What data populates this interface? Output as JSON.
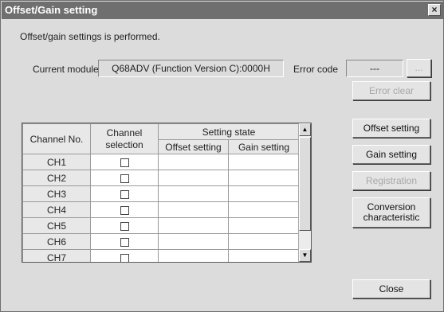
{
  "window": {
    "title": "Offset/Gain setting",
    "close_glyph": "×"
  },
  "message": "Offset/gain settings is performed.",
  "module": {
    "label": "Current module",
    "value": "Q68ADV (Function Version C):0000H"
  },
  "error": {
    "label": "Error code",
    "value": "---",
    "browse_label": "...",
    "clear_label": "Error clear"
  },
  "table": {
    "headers": {
      "channel_no": "Channel No.",
      "channel_selection": "Channel selection",
      "setting_state": "Setting state",
      "offset_setting": "Offset setting",
      "gain_setting": "Gain setting"
    },
    "rows": [
      {
        "channel": "CH1",
        "selected": false,
        "offset": "",
        "gain": ""
      },
      {
        "channel": "CH2",
        "selected": false,
        "offset": "",
        "gain": ""
      },
      {
        "channel": "CH3",
        "selected": false,
        "offset": "",
        "gain": ""
      },
      {
        "channel": "CH4",
        "selected": false,
        "offset": "",
        "gain": ""
      },
      {
        "channel": "CH5",
        "selected": false,
        "offset": "",
        "gain": ""
      },
      {
        "channel": "CH6",
        "selected": false,
        "offset": "",
        "gain": ""
      },
      {
        "channel": "CH7",
        "selected": false,
        "offset": "",
        "gain": ""
      }
    ]
  },
  "buttons": {
    "offset_setting": "Offset setting",
    "gain_setting": "Gain setting",
    "registration": "Registration",
    "conversion_characteristic": "Conversion characteristic",
    "close": "Close"
  },
  "icons": {
    "scroll_up": "scroll-up-arrow-icon",
    "scroll_down": "scroll-down-arrow-icon"
  },
  "colors": {
    "title_bar": "#6f6f6f",
    "dialog_bg": "#dcdcdc"
  }
}
